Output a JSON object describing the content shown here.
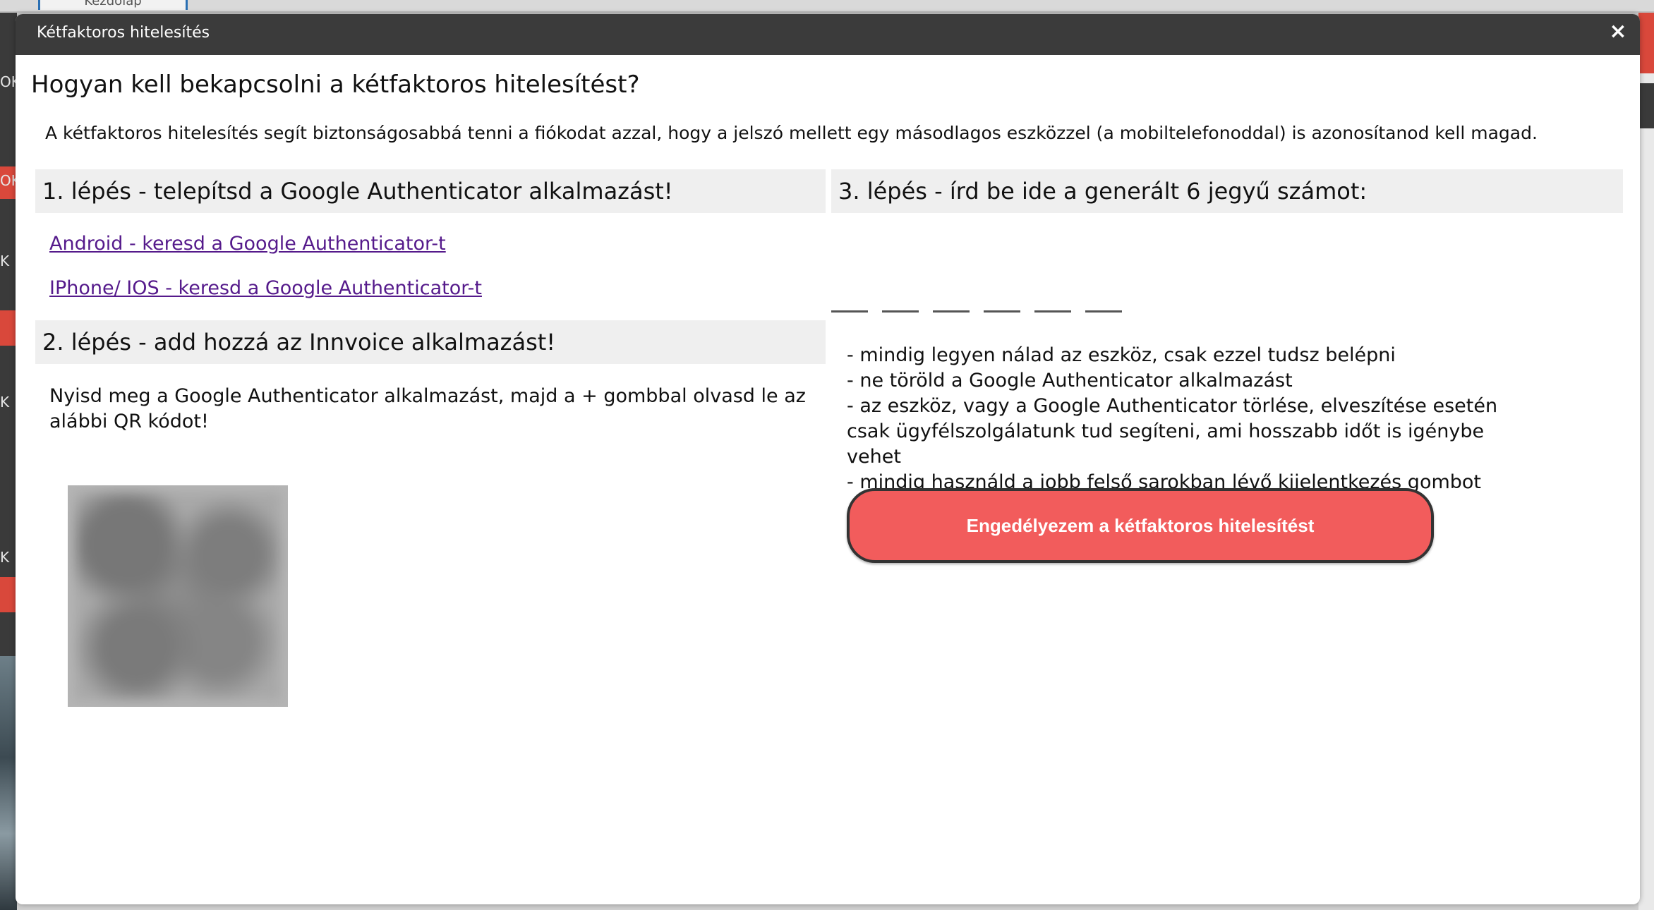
{
  "background": {
    "tab_label": "Kezdőlap",
    "side_fragments": [
      "OK",
      "OK",
      "K",
      "K",
      "K"
    ]
  },
  "modal": {
    "title": "Kétfaktoros hitelesítés",
    "close_label": "×",
    "heading": "Hogyan kell bekapcsolni a kétfaktoros hitelesítést?",
    "intro": "A kétfaktoros hitelesítés segít biztonságosabbá tenni a fiókodat azzal, hogy a jelszó mellett egy másodlagos eszközzel (a mobiltelefonoddal) is azonosítanod kell magad.",
    "step1": {
      "title": "1. lépés - telepítsd a Google Authenticator alkalmazást!",
      "links": [
        "Android - keresd a Google Authenticator-t",
        "IPhone/ IOS - keresd a Google Authenticator-t"
      ]
    },
    "step2": {
      "title": "2. lépés - add hozzá az Innvoice alkalmazást!",
      "description": "Nyisd meg a Google Authenticator alkalmazást, majd a + gombbal olvasd le az alábbi QR kódot!",
      "qr_icon": "qr-code-icon"
    },
    "step3": {
      "title": "3. lépés - írd be ide a generált 6 jegyű számot:",
      "code_digits": [
        "",
        "",
        "",
        "",
        "",
        ""
      ],
      "notes": [
        "- mindig legyen nálad az eszköz, csak ezzel tudsz belépni",
        "- ne töröld a Google Authenticator alkalmazást",
        "- az eszköz, vagy a Google Authenticator törlése, elveszítése esetén csak ügyfélszolgálatunk tud segíteni, ami hosszabb időt is igénybe vehet",
        "- mindig használd a jobb felső sarokban lévő kijelentkezés gombot"
      ],
      "enable_button": "Engedélyezem a kétfaktoros hitelesítést"
    }
  },
  "colors": {
    "titlebar": "#3b3b3b",
    "section_bg": "#efefef",
    "link": "#551a8b",
    "button": "#f25c5c"
  }
}
